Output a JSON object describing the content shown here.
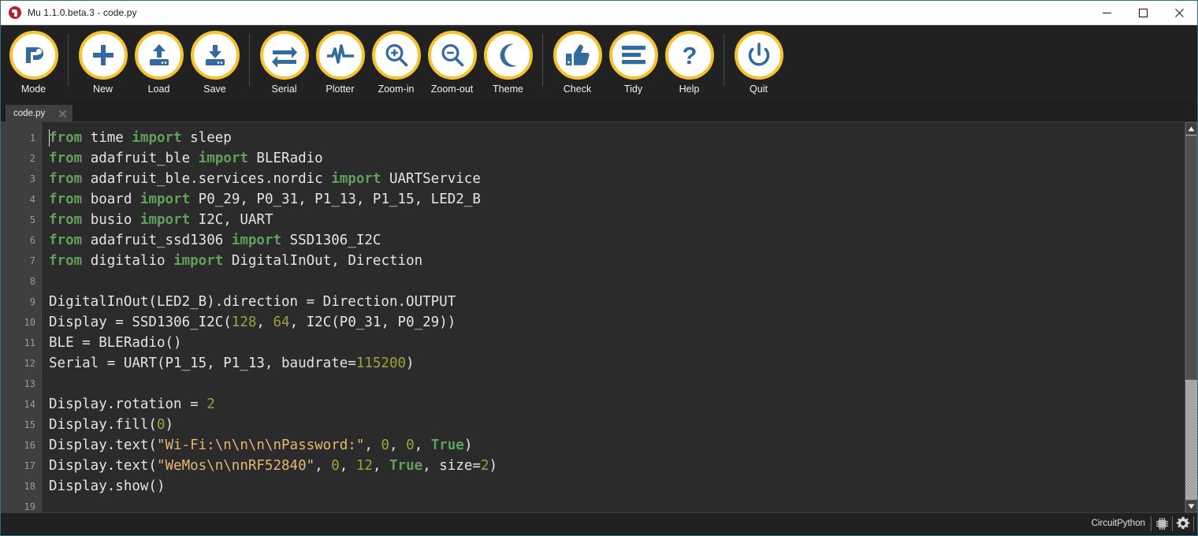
{
  "window": {
    "title": "Mu 1.1.0.beta.3 - code.py",
    "app_icon": "mu-logo-icon",
    "controls": {
      "minimize": "minimize-icon",
      "maximize": "maximize-icon",
      "close": "close-icon"
    }
  },
  "toolbar": {
    "accent_color": "#f5c231",
    "background": "#212121",
    "items": [
      {
        "label": "Mode",
        "icon": "mode-icon"
      },
      {
        "label": "New",
        "icon": "plus-icon"
      },
      {
        "label": "Load",
        "icon": "upload-drive-icon"
      },
      {
        "label": "Save",
        "icon": "download-drive-icon"
      },
      {
        "label": "Serial",
        "icon": "transfer-arrows-icon"
      },
      {
        "label": "Plotter",
        "icon": "waveform-icon"
      },
      {
        "label": "Zoom-in",
        "icon": "magnifier-plus-icon"
      },
      {
        "label": "Zoom-out",
        "icon": "magnifier-minus-icon"
      },
      {
        "label": "Theme",
        "icon": "moon-icon"
      },
      {
        "label": "Check",
        "icon": "thumbs-up-icon"
      },
      {
        "label": "Tidy",
        "icon": "lines-icon"
      },
      {
        "label": "Help",
        "icon": "question-mark-icon"
      },
      {
        "label": "Quit",
        "icon": "power-icon"
      }
    ],
    "separator_after": [
      0,
      3,
      8,
      11
    ]
  },
  "tabs": [
    {
      "name": "code.py",
      "close_icon": "close-icon",
      "active": true
    }
  ],
  "editor": {
    "background": "#2b2b2b",
    "gutter_background": "#3f3f3f",
    "first_line": 1,
    "line_numbers": [
      1,
      2,
      3,
      4,
      5,
      6,
      7,
      8,
      9,
      10,
      11,
      12,
      13,
      14,
      15,
      16,
      17,
      18,
      19
    ],
    "colors": {
      "keyword": "#61a05c",
      "number": "#a0a03c",
      "string": "#e4b870",
      "text": "#e4e4e4"
    },
    "lines": [
      [
        {
          "t": "from",
          "c": "kw"
        },
        {
          "t": " time ",
          "c": "plain"
        },
        {
          "t": "import",
          "c": "kw"
        },
        {
          "t": " sleep",
          "c": "plain"
        }
      ],
      [
        {
          "t": "from",
          "c": "kw"
        },
        {
          "t": " adafruit_ble ",
          "c": "plain"
        },
        {
          "t": "import",
          "c": "kw"
        },
        {
          "t": " BLERadio",
          "c": "plain"
        }
      ],
      [
        {
          "t": "from",
          "c": "kw"
        },
        {
          "t": " adafruit_ble.services.nordic ",
          "c": "plain"
        },
        {
          "t": "import",
          "c": "kw"
        },
        {
          "t": " UARTService",
          "c": "plain"
        }
      ],
      [
        {
          "t": "from",
          "c": "kw"
        },
        {
          "t": " board ",
          "c": "plain"
        },
        {
          "t": "import",
          "c": "kw"
        },
        {
          "t": " P0_29, P0_31, P1_13, P1_15, LED2_B",
          "c": "plain"
        }
      ],
      [
        {
          "t": "from",
          "c": "kw"
        },
        {
          "t": " busio ",
          "c": "plain"
        },
        {
          "t": "import",
          "c": "kw"
        },
        {
          "t": " I2C, UART",
          "c": "plain"
        }
      ],
      [
        {
          "t": "from",
          "c": "kw"
        },
        {
          "t": " adafruit_ssd1306 ",
          "c": "plain"
        },
        {
          "t": "import",
          "c": "kw"
        },
        {
          "t": " SSD1306_I2C",
          "c": "plain"
        }
      ],
      [
        {
          "t": "from",
          "c": "kw"
        },
        {
          "t": " digitalio ",
          "c": "plain"
        },
        {
          "t": "import",
          "c": "kw"
        },
        {
          "t": " DigitalInOut, Direction",
          "c": "plain"
        }
      ],
      [],
      [
        {
          "t": "DigitalInOut(LED2_B).direction = Direction.OUTPUT",
          "c": "plain"
        }
      ],
      [
        {
          "t": "Display = SSD1306_I2C(",
          "c": "plain"
        },
        {
          "t": "128",
          "c": "num"
        },
        {
          "t": ", ",
          "c": "plain"
        },
        {
          "t": "64",
          "c": "num"
        },
        {
          "t": ", I2C(P0_31, P0_29))",
          "c": "plain"
        }
      ],
      [
        {
          "t": "BLE = BLERadio()",
          "c": "plain"
        }
      ],
      [
        {
          "t": "Serial = UART(P1_15, P1_13, baudrate=",
          "c": "plain"
        },
        {
          "t": "115200",
          "c": "num"
        },
        {
          "t": ")",
          "c": "plain"
        }
      ],
      [],
      [
        {
          "t": "Display.rotation = ",
          "c": "plain"
        },
        {
          "t": "2",
          "c": "num"
        }
      ],
      [
        {
          "t": "Display.fill(",
          "c": "plain"
        },
        {
          "t": "0",
          "c": "num"
        },
        {
          "t": ")",
          "c": "plain"
        }
      ],
      [
        {
          "t": "Display.text(",
          "c": "plain"
        },
        {
          "t": "\"Wi-Fi:\\n\\n\\n\\nPassword:\"",
          "c": "str"
        },
        {
          "t": ", ",
          "c": "plain"
        },
        {
          "t": "0",
          "c": "num"
        },
        {
          "t": ", ",
          "c": "plain"
        },
        {
          "t": "0",
          "c": "num"
        },
        {
          "t": ", ",
          "c": "plain"
        },
        {
          "t": "True",
          "c": "kw"
        },
        {
          "t": ")",
          "c": "plain"
        }
      ],
      [
        {
          "t": "Display.text(",
          "c": "plain"
        },
        {
          "t": "\"WeMos\\n\\nnRF52840\"",
          "c": "str"
        },
        {
          "t": ", ",
          "c": "plain"
        },
        {
          "t": "0",
          "c": "num"
        },
        {
          "t": ", ",
          "c": "plain"
        },
        {
          "t": "12",
          "c": "num"
        },
        {
          "t": ", ",
          "c": "plain"
        },
        {
          "t": "True",
          "c": "kw"
        },
        {
          "t": ", size=",
          "c": "plain"
        },
        {
          "t": "2",
          "c": "num"
        },
        {
          "t": ")",
          "c": "plain"
        }
      ],
      [
        {
          "t": "Display.show()",
          "c": "plain"
        }
      ],
      []
    ]
  },
  "scrollbar": {
    "up_icon": "scroll-up-arrow-icon",
    "down_icon": "scroll-down-arrow-icon"
  },
  "statusbar": {
    "mode_label": "CircuitPython",
    "icons": [
      {
        "name": "chip-icon"
      },
      {
        "name": "gear-icon"
      }
    ]
  }
}
